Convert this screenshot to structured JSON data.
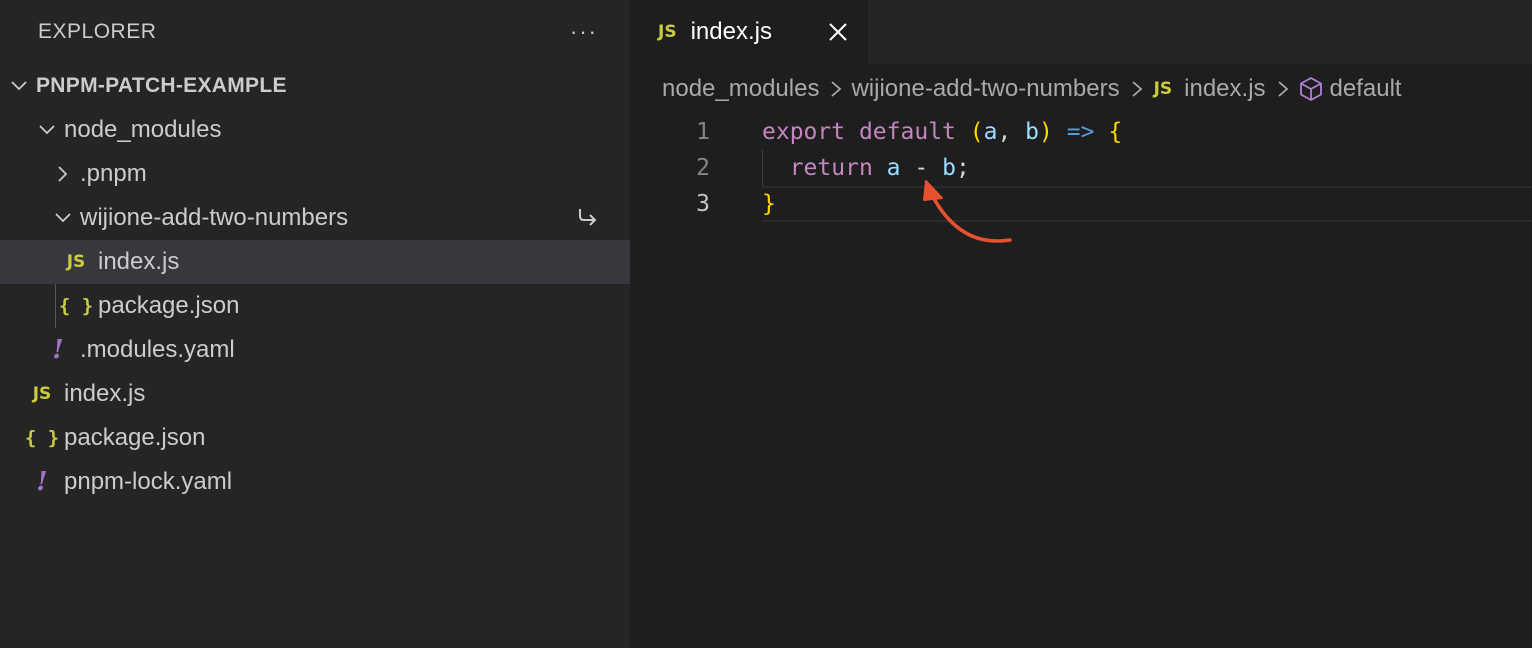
{
  "sidebar": {
    "title": "EXPLORER",
    "more_label": "···",
    "root": "PNPM-PATCH-EXAMPLE",
    "items": [
      {
        "label": "node_modules"
      },
      {
        "label": ".pnpm"
      },
      {
        "label": "wijione-add-two-numbers"
      },
      {
        "label": "index.js",
        "icon": "js-icon"
      },
      {
        "label": "package.json",
        "icon": "json-icon"
      },
      {
        "label": ".modules.yaml",
        "icon": "yaml-icon"
      },
      {
        "label": "index.js",
        "icon": "js-icon"
      },
      {
        "label": "package.json",
        "icon": "json-icon"
      },
      {
        "label": "pnpm-lock.yaml",
        "icon": "yaml-icon"
      }
    ],
    "icons": {
      "js": "JS",
      "json": "{ }",
      "yaml": "!"
    }
  },
  "editor": {
    "tab": {
      "label": "index.js",
      "icon": "JS"
    },
    "breadcrumb": {
      "items": [
        "node_modules",
        "wijione-add-two-numbers",
        "index.js",
        "default"
      ]
    },
    "code": {
      "line_numbers": [
        "1",
        "2",
        "3"
      ],
      "line1": {
        "export": "export",
        "default": "default",
        "open_paren": "(",
        "a": "a",
        "comma": ", ",
        "b": "b",
        "close_paren": ")",
        "arrow": "=>",
        "open_brace": "{"
      },
      "line2": {
        "return": "return",
        "a": "a",
        "op": "-",
        "b": "b",
        "semi": ";"
      },
      "line3": {
        "close_brace": "}"
      }
    }
  },
  "colors": {
    "sidebar_bg": "#252526",
    "editor_bg": "#1e1e1e",
    "selected_row": "#37373d",
    "annotation_arrow": "#e8512e"
  }
}
